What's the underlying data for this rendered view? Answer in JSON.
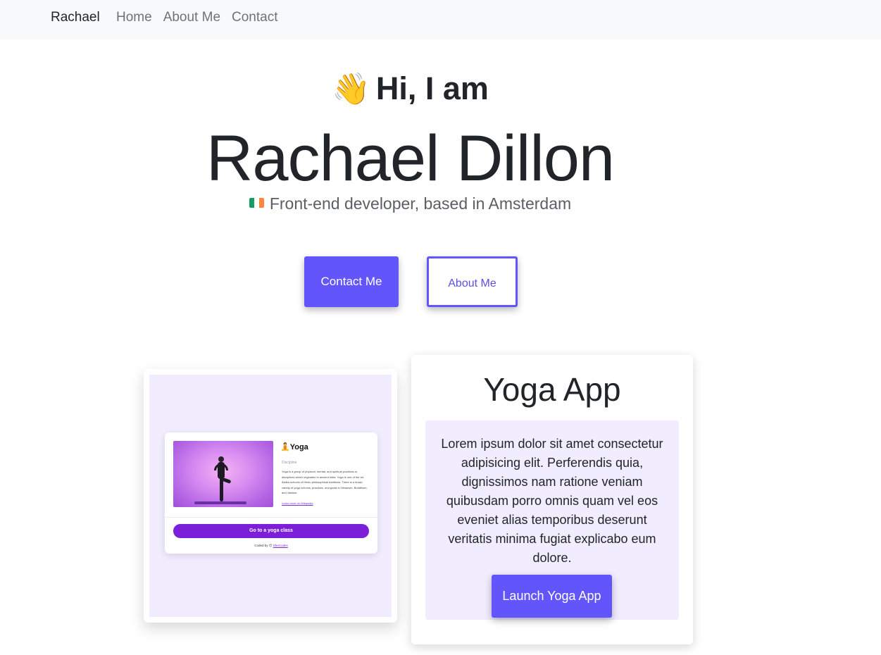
{
  "navbar": {
    "brand": "Rachael",
    "links": [
      "Home",
      "About Me",
      "Contact"
    ]
  },
  "hero": {
    "greeting_emoji": "👋",
    "greeting": "Hi, I am",
    "name": "Rachael Dillon",
    "subtitle": "Front-end developer, based in Amsterdam",
    "flag_colors": [
      "#169b62",
      "#ffffff",
      "#ff883e"
    ]
  },
  "buttons": {
    "contact": "Contact Me",
    "about": "About Me"
  },
  "preview": {
    "title_emoji": "🧘",
    "title": "Yoga",
    "discipline_label": "Discipline",
    "description": "Yoga is a group of physical, mental, and spiritual practices or disciplines which originated in ancient India. Yoga is one of the six Āstika schools of Hindu philosophical traditions. There is a broad variety of yoga schools, practices, and goals in Hinduism, Buddhism, and Jainism.",
    "link": "Learn more on Wikipedia",
    "button": "Go to a yoga class",
    "footer_prefix": "Coded by",
    "footer_emoji": "😊",
    "footer_link": "SheCodes"
  },
  "project": {
    "title": "Yoga App",
    "description": "Lorem ipsum dolor sit amet consectetur adipisicing elit. Perferendis quia, dignissimos nam ratione veniam quibusdam porro omnis quam vel eos eveniet alias temporibus deserunt veritatis minima fugiat explicabo eum dolore.",
    "button": "Launch Yoga App"
  },
  "colors": {
    "accent": "#6155fb",
    "panel": "#f1edfe",
    "navbar_bg": "#f8f9fa"
  }
}
